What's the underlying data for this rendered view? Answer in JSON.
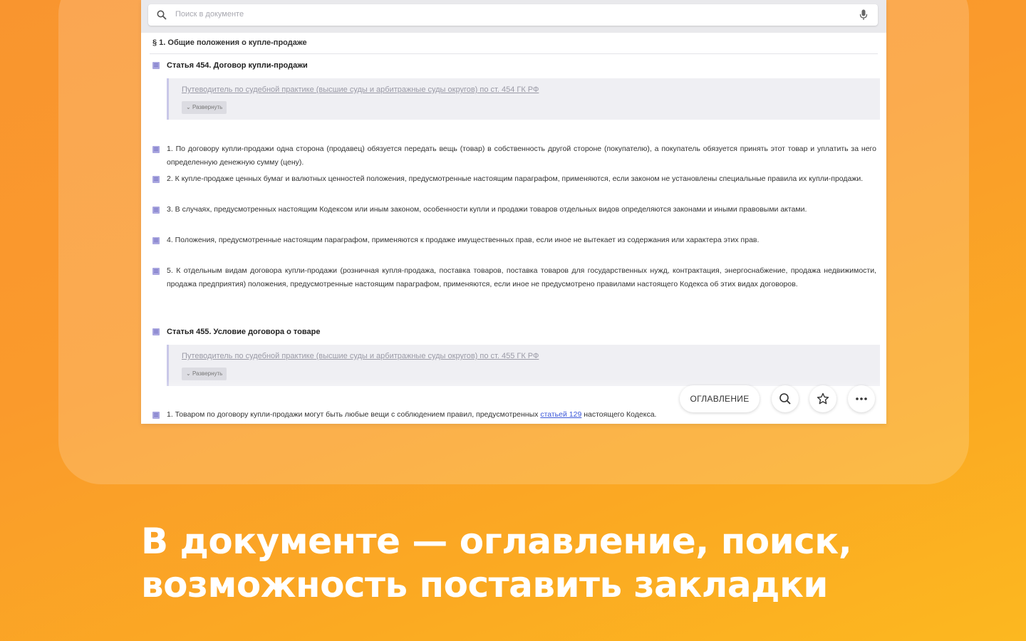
{
  "search": {
    "placeholder": "Поиск в документе"
  },
  "document": {
    "section_title": "§ 1. Общие положения о купле-продаже",
    "articles": [
      {
        "title": "Статья 454. Договор купли-продажи",
        "guide_link": "Путеводитель по судебной практике (высшие суды и арбитражные суды округов) по ст. 454 ГК РФ",
        "expand_label": "Развернуть",
        "paragraphs": [
          "1. По договору купли-продажи одна сторона (продавец) обязуется передать вещь (товар) в собственность другой стороне (покупателю), а покупатель обязуется принять этот товар и уплатить за него определенную денежную сумму (цену).",
          "2. К купле-продаже ценных бумаг и валютных ценностей положения, предусмотренные настоящим параграфом, применяются, если законом не установлены специальные правила их купли-продажи.",
          "3. В случаях, предусмотренных настоящим Кодексом или иным законом, особенности купли и продажи товаров отдельных видов определяются законами и иными правовыми актами.",
          "4. Положения, предусмотренные настоящим параграфом, применяются к продаже имущественных прав, если иное не вытекает из содержания или характера этих прав.",
          "5. К отдельным видам договора купли-продажи (розничная купля-продажа, поставка товаров, поставка товаров для государственных нужд, контрактация, энергоснабжение, продажа недвижимости, продажа предприятия) положения, предусмотренные настоящим параграфом, применяются, если иное не предусмотрено правилами настоящего Кодекса об этих видах договоров."
        ]
      },
      {
        "title": "Статья 455. Условие договора о товаре",
        "guide_link": "Путеводитель по судебной практике (высшие суды и арбитражные суды округов) по ст. 455 ГК РФ",
        "expand_label": "Развернуть",
        "paragraph_before": "1. Товаром по договору купли-продажи могут быть любые вещи с соблюдением правил, предусмотренных ",
        "paragraph_link": "статьей 129",
        "paragraph_after": " настоящего Кодекса."
      }
    ]
  },
  "toolbar": {
    "toc_label": "ОГЛАВЛЕНИЕ",
    "search_icon": "search-icon",
    "bookmark_icon": "star-icon",
    "more_icon": "more-icon"
  },
  "caption": {
    "line1": "В документе — оглавление, поиск,",
    "line2": "возможность поставить закладки"
  }
}
